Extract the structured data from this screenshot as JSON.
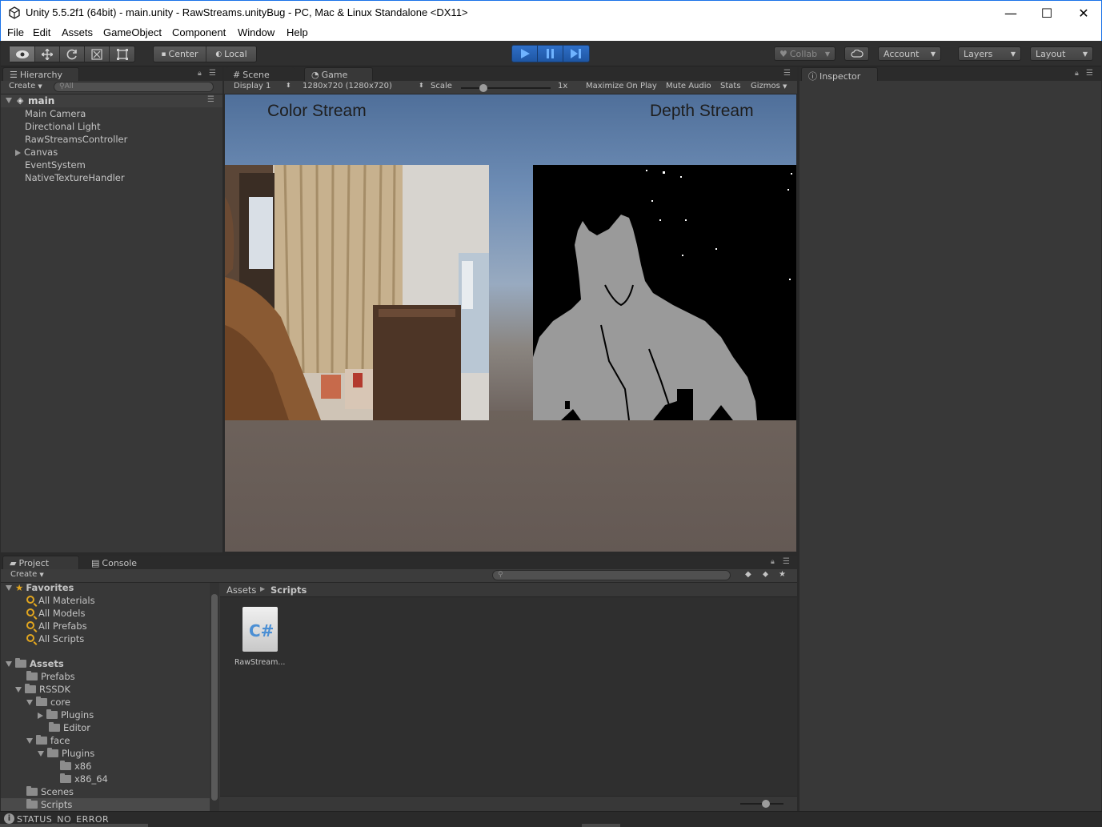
{
  "window": {
    "title": "Unity 5.5.2f1 (64bit) - main.unity - RawStreams.unityBug - PC, Mac & Linux Standalone <DX11>",
    "minimize": "—",
    "maximize": "☐",
    "close": "✕"
  },
  "menu": [
    "File",
    "Edit",
    "Assets",
    "GameObject",
    "Component",
    "Window",
    "Help"
  ],
  "toolbar": {
    "pivot": "Center",
    "space": "Local",
    "collab": "Collab",
    "account": "Account",
    "layers": "Layers",
    "layout": "Layout"
  },
  "hierarchy": {
    "tab": "Hierarchy",
    "create": "Create",
    "search_placeholder": "All",
    "scene": "main",
    "items": [
      "Main Camera",
      "Directional Light",
      "RawStreamsController",
      "Canvas",
      "EventSystem",
      "NativeTextureHandler"
    ]
  },
  "center": {
    "tabs": [
      "Scene",
      "Game"
    ],
    "display": "Display 1",
    "resolution": "1280x720 (1280x720)",
    "scale_label": "Scale",
    "scale_value": "1x",
    "buttons": [
      "Maximize On Play",
      "Mute Audio",
      "Stats",
      "Gizmos"
    ],
    "color_title": "Color Stream",
    "depth_title": "Depth Stream"
  },
  "inspector": {
    "tab": "Inspector"
  },
  "project": {
    "tabs": [
      "Project",
      "Console"
    ],
    "create": "Create",
    "favorites_label": "Favorites",
    "favorites": [
      "All Materials",
      "All Models",
      "All Prefabs",
      "All Scripts"
    ],
    "assets_label": "Assets",
    "tree": [
      "Prefabs",
      "RSSDK",
      "core",
      "Plugins",
      "Editor",
      "face",
      "Plugins",
      "x86",
      "x86_64",
      "Scenes",
      "Scripts"
    ],
    "breadcrumb": [
      "Assets",
      "Scripts"
    ],
    "file_name": "RawStream...",
    "file_icon_text": "C#"
  },
  "status": {
    "text": "STATUS_NO_ERROR"
  },
  "colors": {
    "accent": "#1e56a4",
    "panel": "#383838",
    "toolbar": "#2f2f2f"
  }
}
